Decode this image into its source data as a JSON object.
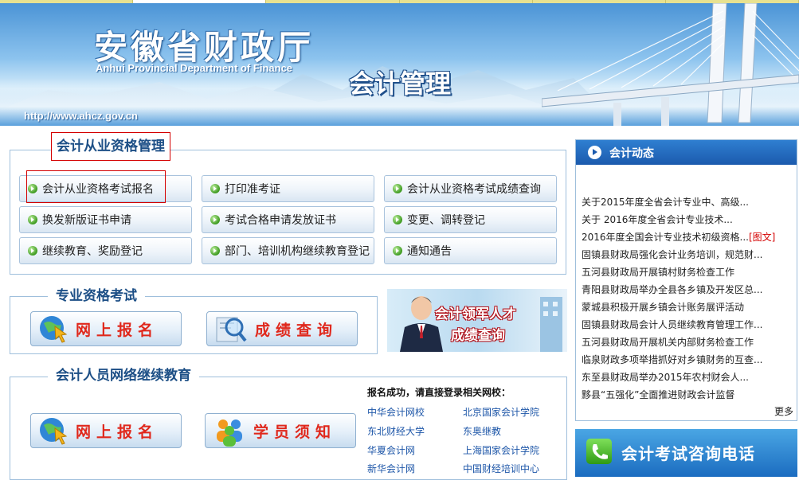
{
  "banner": {
    "title": "安徽省财政厅",
    "english": "Anhui Provincial Department of Finance",
    "subtitle": "会计管理",
    "url": "http://www.ahcz.gov.cn"
  },
  "qualification": {
    "title": "会计从业资格管理",
    "items": [
      {
        "label": "会计从业资格考试报名"
      },
      {
        "label": "打印准考证"
      },
      {
        "label": "会计从业资格考试成绩查询"
      },
      {
        "label": "换发新版证书申请"
      },
      {
        "label": "考试合格申请发放证书"
      },
      {
        "label": "变更、调转登记"
      },
      {
        "label": "继续教育、奖励登记"
      },
      {
        "label": "部门、培训机构继续教育登记"
      },
      {
        "label": "通知通告"
      }
    ]
  },
  "professional": {
    "title": "专业资格考试",
    "online_label": "网上报名",
    "score_label": "成绩查询"
  },
  "ad": {
    "line1": "会计领军人才",
    "line2": "成绩查询"
  },
  "network": {
    "title": "会计人员网络继续教育",
    "online_label": "网上报名",
    "notice_label": "学员须知",
    "schools_heading": "报名成功，请直接登录相关网校：",
    "schools": [
      "中华会计网校",
      "北京国家会计学院",
      "东北财经大学",
      "东奥继教",
      "华夏会计网",
      "上海国家会计学院",
      "新华会计网",
      "中国财经培训中心"
    ]
  },
  "news": {
    "title": "会计动态",
    "items": [
      {
        "text": "关于2015年度全省会计专业中、高级...",
        "tag": ""
      },
      {
        "text": "关于 2016年度全省会计专业技术...",
        "tag": ""
      },
      {
        "text": "2016年度全国会计专业技术初级资格...",
        "tag": "[图文]"
      },
      {
        "text": "固镇县财政局强化会计业务培训，规范财...",
        "tag": ""
      },
      {
        "text": "五河县财政局开展镇村财务检查工作",
        "tag": ""
      },
      {
        "text": "青阳县财政局举办全县各乡镇及开发区总...",
        "tag": ""
      },
      {
        "text": "蒙城县积极开展乡镇会计账务展评活动",
        "tag": ""
      },
      {
        "text": "固镇县财政局会计人员继续教育管理工作...",
        "tag": ""
      },
      {
        "text": "五河县财政局开展机关内部财务检查工作",
        "tag": ""
      },
      {
        "text": "临泉财政多项举措抓好对乡镇财务的互查...",
        "tag": ""
      },
      {
        "text": "东至县财政局举办2015年农村财会人...",
        "tag": ""
      },
      {
        "text": "黟县“五强化”全面推进财政会计监督",
        "tag": ""
      }
    ],
    "more_label": "更多"
  },
  "hotline": {
    "label": "会计考试咨询电话"
  },
  "colors": {
    "accent_blue": "#1d4f86",
    "link_blue": "#1d56a8",
    "red": "#d40000"
  }
}
